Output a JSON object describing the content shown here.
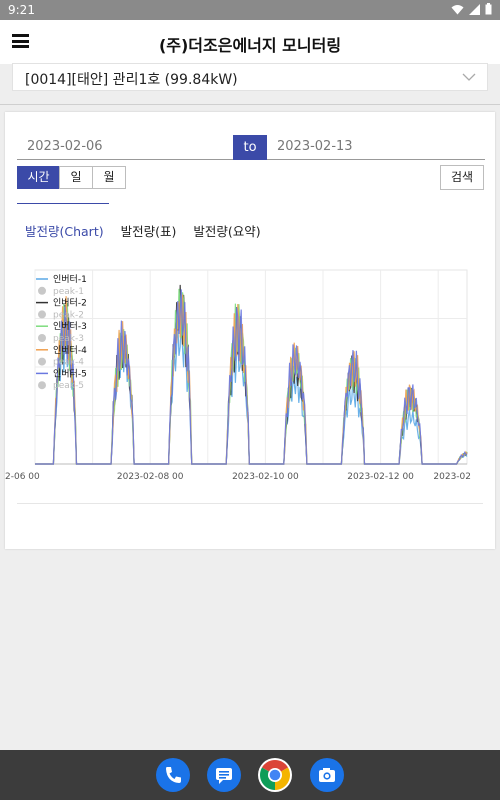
{
  "status": {
    "time": "9:21"
  },
  "app": {
    "title": "(주)더조은에너지 모니터링"
  },
  "plant": {
    "selected": "[0014][태안] 관리1호 (99.84kW)"
  },
  "filter": {
    "start_date": "2023-02-06",
    "to_label": "to",
    "end_date": "2023-02-13",
    "periods": [
      "시간",
      "일",
      "월"
    ],
    "active_period": "시간",
    "search_label": "검색"
  },
  "tabs": [
    {
      "label": "발전량(Chart)",
      "active": true
    },
    {
      "label": "발전량(표)",
      "active": false
    },
    {
      "label": "발전량(요약)",
      "active": false
    }
  ],
  "colors": {
    "accent": "#3b4aa8",
    "inverter_1": "#5aa9e6",
    "inverter_2": "#333333",
    "inverter_3": "#7ddc7d",
    "inverter_4": "#f0a050",
    "inverter_5": "#6a78e0",
    "peak": "#c8c8c8"
  },
  "chart_data": {
    "type": "line",
    "x_tick_labels": [
      "2-06 00",
      "2023-02-08 00",
      "2023-02-10 00",
      "2023-02-12 00",
      "2023-02"
    ],
    "legend_position": "top-left",
    "grid": true,
    "x_range_days": [
      "2023-02-06 00",
      "2023-02-13 12"
    ],
    "series": [
      {
        "name": "인버터-1",
        "peaks": [
          0.66,
          0.6,
          0.7,
          0.6,
          0.44,
          0.4,
          0.26,
          0.05
        ]
      },
      {
        "name": "peak-1",
        "values": []
      },
      {
        "name": "인버터-2",
        "peaks": [
          0.72,
          0.64,
          0.84,
          0.7,
          0.52,
          0.5,
          0.36,
          0.06
        ]
      },
      {
        "name": "peak-2",
        "values": []
      },
      {
        "name": "인버터-3",
        "peaks": [
          0.74,
          0.64,
          0.86,
          0.74,
          0.56,
          0.52,
          0.36,
          0.06
        ]
      },
      {
        "name": "peak-3",
        "values": []
      },
      {
        "name": "인버터-4",
        "peaks": [
          0.76,
          0.66,
          0.84,
          0.74,
          0.58,
          0.54,
          0.38,
          0.06
        ]
      },
      {
        "name": "peak-4",
        "values": []
      },
      {
        "name": "인버터-5",
        "peaks": [
          0.74,
          0.66,
          0.84,
          0.74,
          0.58,
          0.54,
          0.38,
          0.06
        ]
      },
      {
        "name": "peak-5",
        "values": []
      }
    ]
  },
  "nav": {
    "icons": [
      "phone-icon",
      "messages-icon",
      "chrome-icon",
      "camera-icon"
    ]
  }
}
